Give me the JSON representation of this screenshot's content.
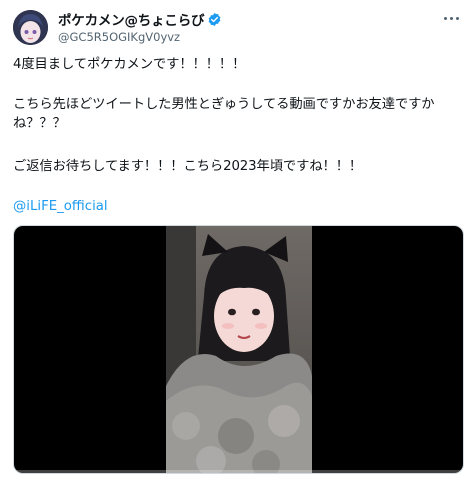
{
  "author": {
    "display_name": "ポケカメン@ちょこらび",
    "handle": "@GC5R5OGIKgV0yvz",
    "avatar": "avatar-image",
    "verified": true
  },
  "icons": {
    "verified": "verified-badge-icon",
    "more": "more-options-icon"
  },
  "colors": {
    "accent": "#1d9bf0",
    "text": "#0f1419",
    "secondary": "#536471"
  },
  "tweet": {
    "line1": "4度目ましてポケカメンです！！！！！",
    "line2": "こちら先ほどツイートした男性とぎゅうしてる動画ですかお友達ですかね？？？",
    "line3": "ご返信お待ちしてます！！！こちら2023年頃ですね！！！",
    "mention": "@iLiFE_official"
  },
  "media": {
    "type": "video",
    "progress": 0
  }
}
